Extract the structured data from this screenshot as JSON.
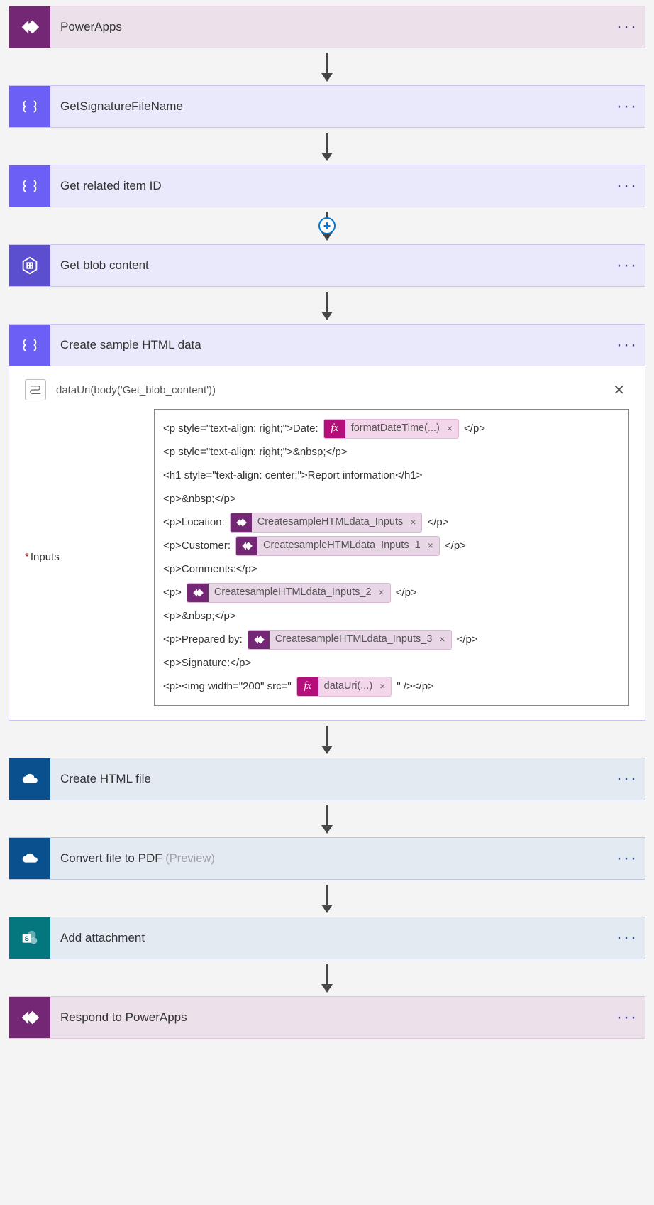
{
  "steps": {
    "s1": {
      "title": "PowerApps"
    },
    "s2": {
      "title": "GetSignatureFileName"
    },
    "s3": {
      "title": "Get related item ID"
    },
    "s4": {
      "title": "Get blob content"
    },
    "s5": {
      "title": "Create sample HTML data"
    },
    "s6": {
      "title": "Create HTML file"
    },
    "s7": {
      "title": "Convert file to PDF",
      "suffix": " (Preview)"
    },
    "s8": {
      "title": "Add attachment"
    },
    "s9": {
      "title": "Respond to PowerApps"
    }
  },
  "expanded": {
    "peek": "dataUri(body('Get_blob_content'))",
    "inputs_label": "Inputs",
    "lines": {
      "l1a": "<p style=\"text-align: right;\">Date:",
      "l1b": "</p>",
      "l2": "<p style=\"text-align: right;\">&nbsp;</p>",
      "l3": "<h1 style=\"text-align: center;\">Report information</h1>",
      "l4": "<p>&nbsp;</p>",
      "l5a": "<p>Location:",
      "l5b": "</p>",
      "l6a": "<p>Customer:",
      "l6b": "</p>",
      "l7": "<p>Comments:</p>",
      "l8a": "<p>",
      "l8b": "</p>",
      "l9": "<p>&nbsp;</p>",
      "l10a": "<p>Prepared by:",
      "l10b": "</p>",
      "l11": "<p>Signature:</p>",
      "l12a": "<p><img width=\"200\" src=\"",
      "l12b": "\" /></p>"
    },
    "tokens": {
      "fx1": "formatDateTime(...)",
      "pa1": "CreatesampleHTMLdata_Inputs",
      "pa2": "CreatesampleHTMLdata_Inputs_1",
      "pa3": "CreatesampleHTMLdata_Inputs_2",
      "pa4": "CreatesampleHTMLdata_Inputs_3",
      "fx2": "dataUri(...)"
    }
  },
  "icons": {
    "plus": "+",
    "fx": "fx",
    "remove": "×"
  }
}
